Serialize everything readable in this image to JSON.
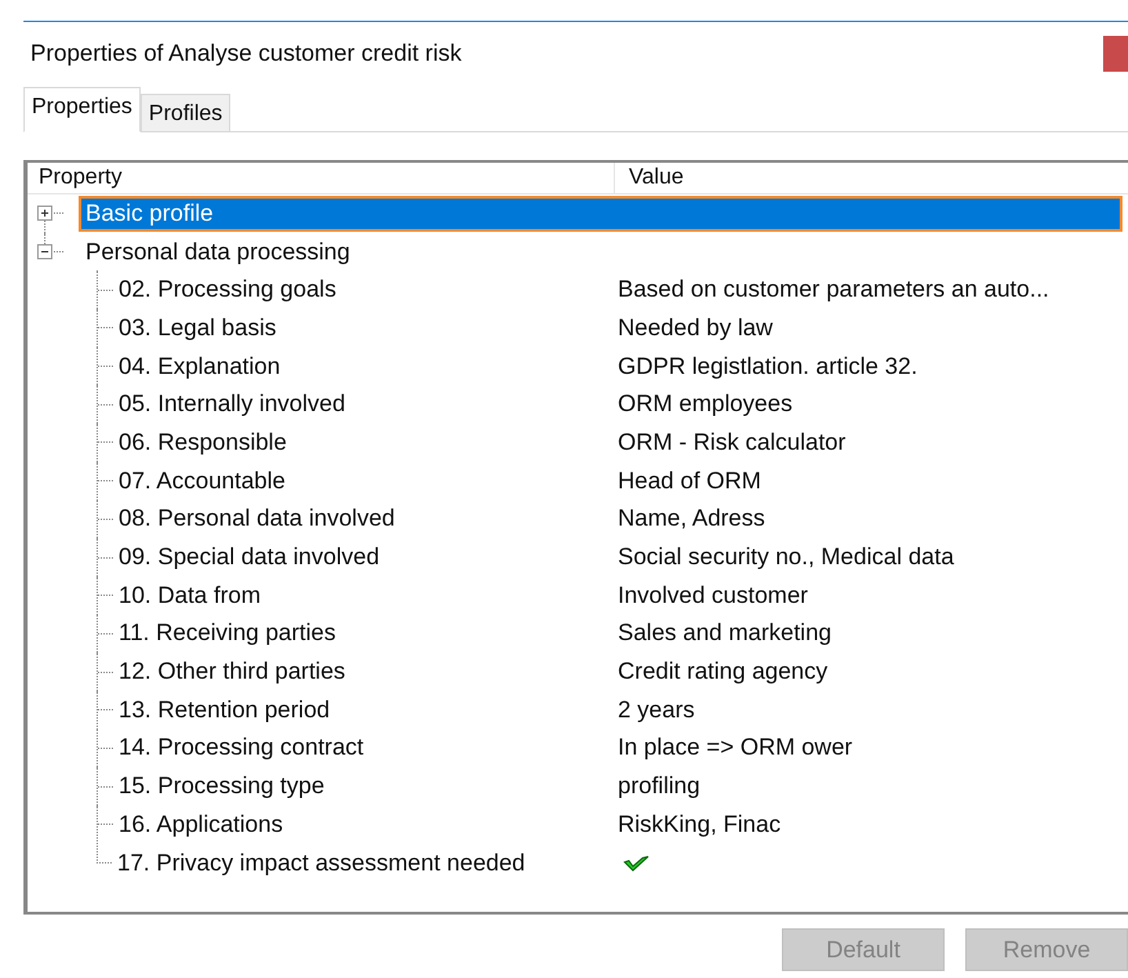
{
  "window": {
    "title": "Properties of Analyse customer credit risk"
  },
  "tabs": [
    {
      "label": "Properties",
      "selected": true
    },
    {
      "label": "Profiles",
      "selected": false
    }
  ],
  "table": {
    "columns": [
      "Property",
      "Value"
    ],
    "tree": [
      {
        "label": "Basic profile",
        "selected": true,
        "expanded": false
      },
      {
        "label": "Personal data processing",
        "selected": false,
        "expanded": true,
        "children": [
          {
            "label": "02. Processing goals",
            "kind": "text",
            "value": "Based on customer parameters an auto..."
          },
          {
            "label": "03. Legal basis",
            "kind": "text",
            "value": "Needed by law"
          },
          {
            "label": "04. Explanation",
            "kind": "text",
            "value": "GDPR legistlation. article 32."
          },
          {
            "label": "05. Internally involved",
            "kind": "text",
            "value": "ORM employees"
          },
          {
            "label": "06. Responsible",
            "kind": "text",
            "value": "ORM - Risk calculator"
          },
          {
            "label": "07. Accountable",
            "kind": "text",
            "value": "Head of ORM"
          },
          {
            "label": "08. Personal data involved",
            "kind": "text",
            "value": "Name, Adress"
          },
          {
            "label": "09. Special data involved",
            "kind": "text",
            "value": "Social security no., Medical data"
          },
          {
            "label": "10. Data from",
            "kind": "text",
            "value": "Involved customer"
          },
          {
            "label": "11. Receiving parties",
            "kind": "text",
            "value": "Sales and marketing"
          },
          {
            "label": "12. Other third parties",
            "kind": "text",
            "value": "Credit rating agency"
          },
          {
            "label": "13. Retention period",
            "kind": "text",
            "value": "2 years"
          },
          {
            "label": "14. Processing contract",
            "kind": "text",
            "value": "In place => ORM ower"
          },
          {
            "label": "15. Processing type",
            "kind": "text",
            "value": "profiling"
          },
          {
            "label": "16. Applications",
            "kind": "text",
            "value": "RiskKing, Finac"
          },
          {
            "label": "17. Privacy impact assessment needed",
            "kind": "check",
            "checked": true
          }
        ]
      }
    ]
  },
  "buttons": [
    {
      "label": "Default",
      "disabled": true
    },
    {
      "label": "Remove",
      "disabled": true
    }
  ]
}
